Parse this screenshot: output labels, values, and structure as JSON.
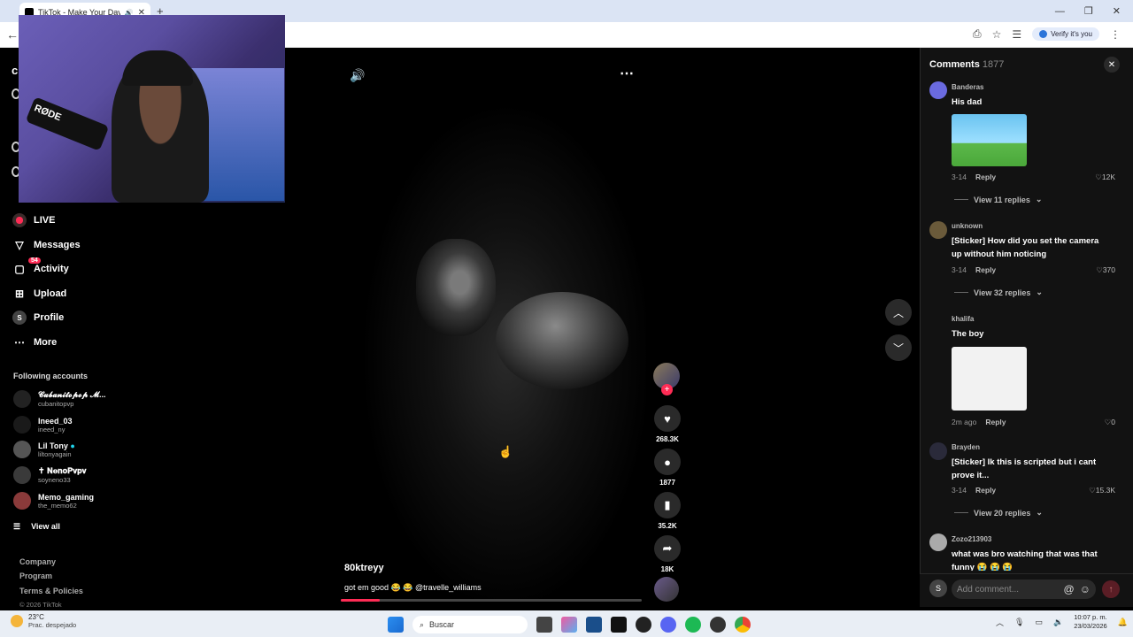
{
  "browser": {
    "tab_title": "TikTok - Make Your Day",
    "verify_label": "Verify it's you"
  },
  "sidebar": {
    "items": [
      {
        "label": "LIVE",
        "icon": "live-icon"
      },
      {
        "label": "Messages",
        "icon": "paper-plane-icon"
      },
      {
        "label": "Activity",
        "icon": "inbox-icon",
        "badge": "54"
      },
      {
        "label": "Upload",
        "icon": "plus-square-icon"
      },
      {
        "label": "Profile",
        "icon": "profile-icon",
        "avatar_letter": "S"
      },
      {
        "label": "More",
        "icon": "ellipsis-icon"
      }
    ],
    "following_title": "Following accounts",
    "accounts": [
      {
        "name": "𝓒𝓾𝓫𝓪𝓷𝓲𝓽𝓸𝓹𝓸𝓹 𝓜...",
        "handle": "cubanitopvp"
      },
      {
        "name": "Ineed_03",
        "handle": "ineed_ny"
      },
      {
        "name": "Lil Tony",
        "handle": "liltonyagain",
        "verified": true
      },
      {
        "name": "✝ 𝐍𝐞𝐧𝐨𝐏𝐯𝐩𝐯",
        "handle": "soyneno33"
      },
      {
        "name": "Memo_gaming",
        "handle": "the_memo62"
      }
    ],
    "view_all": "View all",
    "footer": [
      "Company",
      "Program",
      "Terms & Policies"
    ],
    "copyright": "© 2026 TikTok"
  },
  "video": {
    "author": "80ktreyy",
    "caption": "got em good 😂 😂 @travelle_williams",
    "progress": 0.13
  },
  "actions": {
    "likes": "268.3K",
    "comments": "1877",
    "saves": "35.2K",
    "shares": "18K"
  },
  "comments_panel": {
    "title": "Comments",
    "count": "1877",
    "comments": [
      {
        "user": "Banderas",
        "text": "His dad",
        "date": "3-14",
        "reply": "Reply",
        "likes": "12K",
        "view_replies": "View 11 replies"
      },
      {
        "user": "unknown",
        "text": "[Sticker] How did you set the camera up without him noticing",
        "date": "3-14",
        "reply": "Reply",
        "likes": "370",
        "view_replies": "View 32 replies"
      },
      {
        "user": "khalifa",
        "text": "The boy",
        "date": "2m ago",
        "reply": "Reply",
        "likes": "0"
      },
      {
        "user": "Brayden",
        "text": "[Sticker] Ik this is scripted but i cant prove it...",
        "date": "3-14",
        "reply": "Reply",
        "likes": "15.3K",
        "view_replies": "View 20 replies"
      },
      {
        "user": "Zozo213903",
        "text": "what was bro watching that was that funny 😭 😭 😭"
      }
    ],
    "add_placeholder": "Add comment...",
    "my_avatar": "S"
  },
  "taskbar": {
    "temp": "23°C",
    "weather": "Prac. despejado",
    "search": "Buscar",
    "time": "10:07 p. m.",
    "date": "23/03/2026"
  }
}
